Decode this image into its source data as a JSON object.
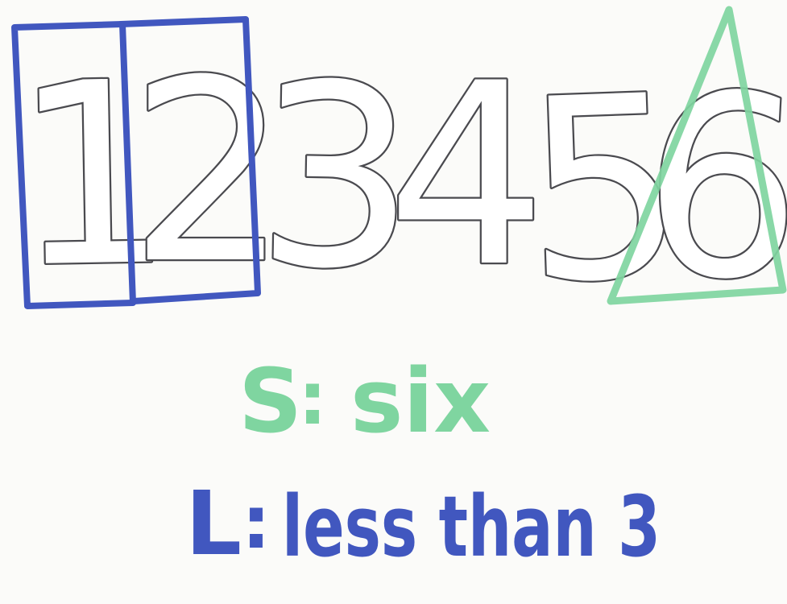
{
  "numbers": [
    "1",
    "2",
    "3",
    "4",
    "5",
    "6"
  ],
  "captions": {
    "small": {
      "letter": "S",
      "separator": ":",
      "text": "six"
    },
    "large": {
      "letter": "L",
      "separator": ":",
      "text": "less than 3"
    }
  },
  "colors": {
    "paper": "#fbfbf9",
    "outline": "#4a4a4f",
    "blue_marker": "#4157bf",
    "green_marker": "#7fd5a0"
  },
  "markings": {
    "blue_boxes": [
      "1",
      "2"
    ],
    "green_triangle": [
      "6"
    ]
  }
}
